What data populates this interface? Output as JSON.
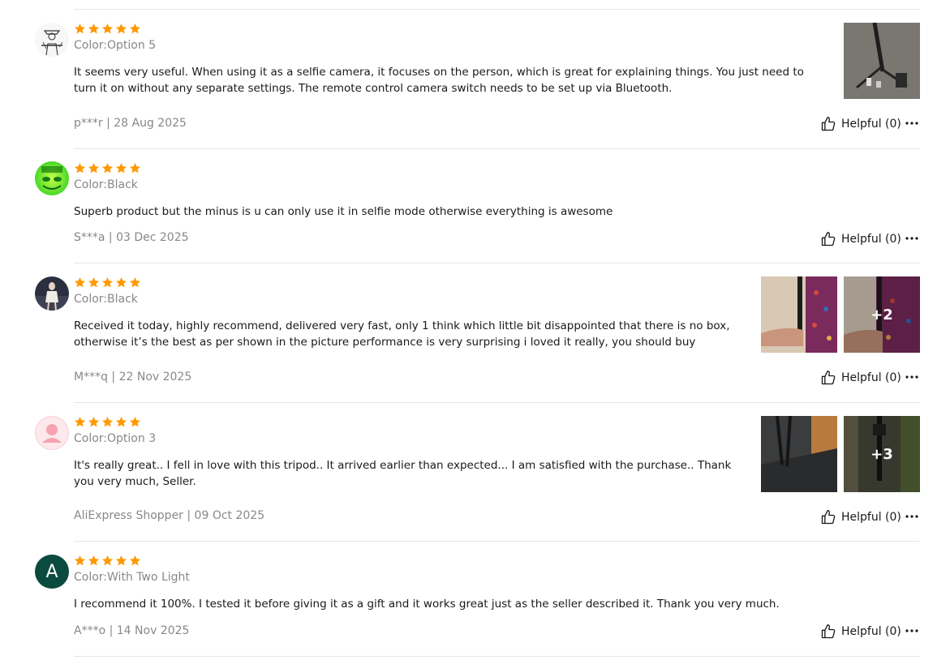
{
  "reviews": [
    {
      "rating": 5,
      "color": "Color:Option 5",
      "text": "It seems very useful. When using it as a selfie camera, it focuses on the person, which is great for explaining things. You just need to turn it on without any separate settings. The remote control camera switch needs to be set up via Bluetooth.",
      "author": "p***r | 28 Aug 2025",
      "helpful": "Helpful (0)",
      "avatar_icon": "sketch-cowboy-avatar"
    },
    {
      "rating": 5,
      "color": "Color:Black",
      "text": "Superb product but the minus is u can only use it in selfie mode otherwise everything is awesome",
      "author": "S***a | 03 Dec 2025",
      "helpful": "Helpful (0)",
      "avatar_icon": "green-graphic-avatar"
    },
    {
      "rating": 5,
      "color": "Color:Black",
      "text": "Received it today, highly recommend, delivered very fast, only 1 think which little bit disappointed that there is no box, otherwise it’s the best as per shown in the picture performance is very surprising i loved it really, you should buy",
      "author": "M***q | 22 Nov 2025",
      "helpful": "Helpful (0)",
      "more_photos": "+2",
      "avatar_icon": "person-photo-avatar"
    },
    {
      "rating": 5,
      "color": "Color:Option 3",
      "text": "It's really great.. I fell in love with this tripod.. It arrived earlier than expected... I am satisfied with the purchase.. Thank you very much, Seller.",
      "author": "AliExpress Shopper | 09 Oct 2025",
      "helpful": "Helpful (0)",
      "more_photos": "+3",
      "avatar_icon": "default-user-avatar"
    },
    {
      "rating": 5,
      "color": "Color:With Two Light",
      "text": "I recommend it 100%. I tested it before giving it as a gift and it works great just as the seller described it. Thank you very much.",
      "author": "A***o | 14 Nov 2025",
      "helpful": "Helpful (0)",
      "avatar_letter": "A"
    }
  ],
  "colors": {
    "star": "#FF9900",
    "avatar_letter_bg": "#0B4A3F",
    "muted_text": "#888888",
    "divider": "#E6E6E6"
  }
}
